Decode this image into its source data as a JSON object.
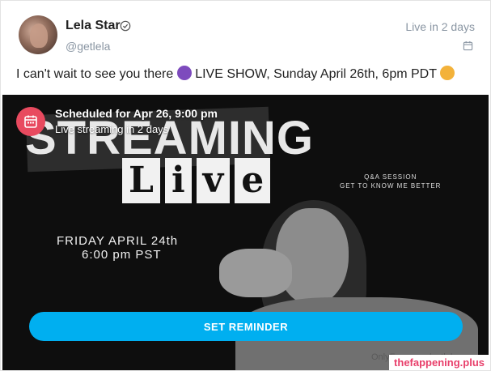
{
  "post": {
    "author_name": "Lela Star",
    "author_handle": "@getlela",
    "live_in": "Live in 2 days",
    "text_main": "I can't wait to see you there",
    "text_show": "LIVE SHOW, Sunday April 26th, 6pm PDT",
    "icons": {
      "verified": "verified-check-icon",
      "calendar": "calendar-icon",
      "devil": "smiling-devil-emoji",
      "tongue": "winking-tongue-emoji"
    }
  },
  "media": {
    "scheduled_title": "Scheduled for Apr 26, 9:00 pm",
    "scheduled_sub": "Live streaming in 2 days",
    "poster_heading": "STREAMING",
    "poster_live": [
      "L",
      "i",
      "v",
      "e"
    ],
    "poster_qa_1": "Q&A SESSION",
    "poster_qa_2": "GET TO KNOW ME BETTER",
    "poster_date": "FRIDAY APRIL 24th",
    "poster_time": "6:00 pm PST",
    "watermark": "OnlyFans.com/getlela",
    "reminder_label": "SET REMINDER",
    "site_tag": "thefappening.plus"
  },
  "colors": {
    "accent": "#00aff0",
    "schedule_icon_bg": "#e84a5f",
    "muted": "#8a96a3"
  }
}
